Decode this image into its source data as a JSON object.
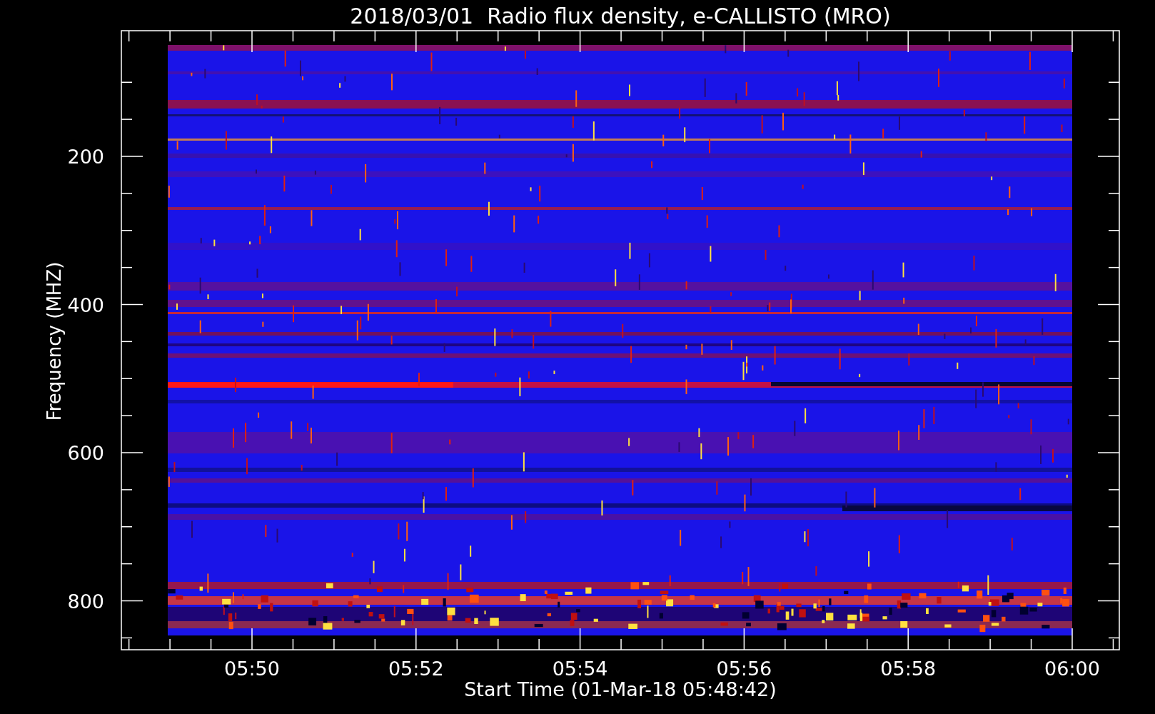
{
  "title": "2018/03/01  Radio flux density, e-CALLISTO (MRO)",
  "y_axis": {
    "label": "Frequency (MHZ)",
    "ticks": [
      "200",
      "400",
      "600",
      "800"
    ]
  },
  "x_axis": {
    "label": "Start Time (01-Mar-18 05:48:42)",
    "ticks": [
      "05:50",
      "05:52",
      "05:54",
      "05:56",
      "05:58",
      "06:00"
    ]
  }
}
